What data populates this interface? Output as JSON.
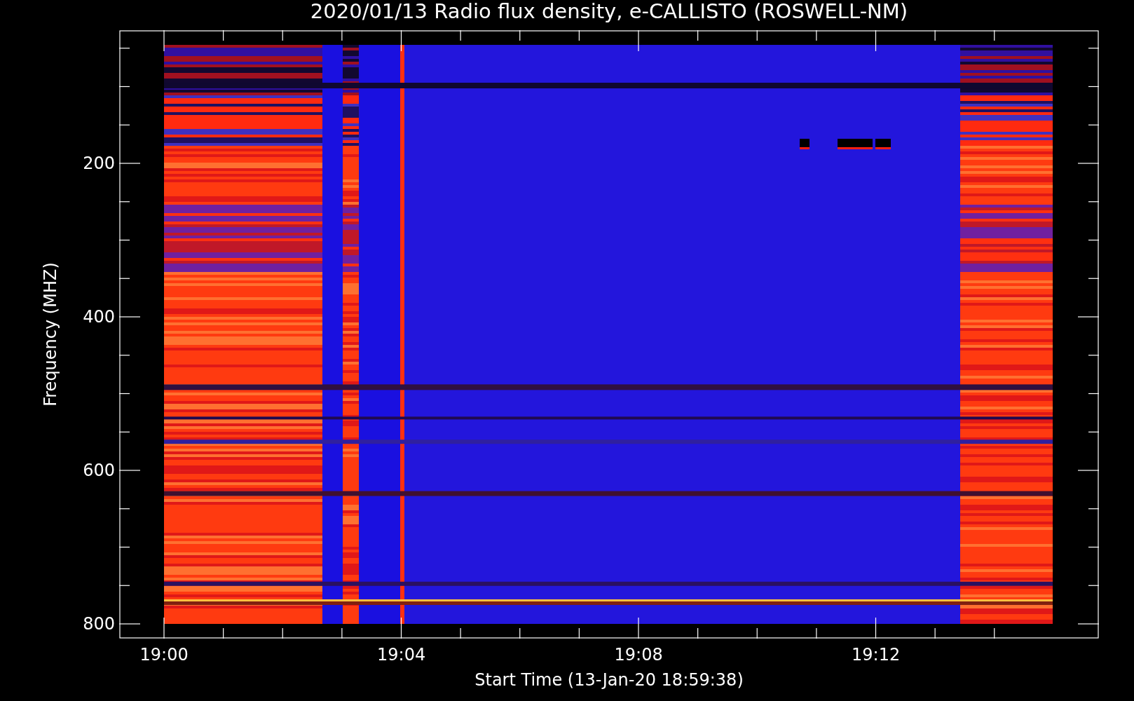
{
  "title": "2020/01/13  Radio flux density, e-CALLISTO (ROSWELL-NM)",
  "y_axis": {
    "label": "Frequency (MHZ)",
    "tick_labels": [
      "200",
      "400",
      "600",
      "800"
    ]
  },
  "x_axis": {
    "label": "Start Time (13-Jan-20 18:59:38)",
    "tick_labels": [
      "19:00",
      "19:04",
      "19:08",
      "19:12"
    ]
  }
}
